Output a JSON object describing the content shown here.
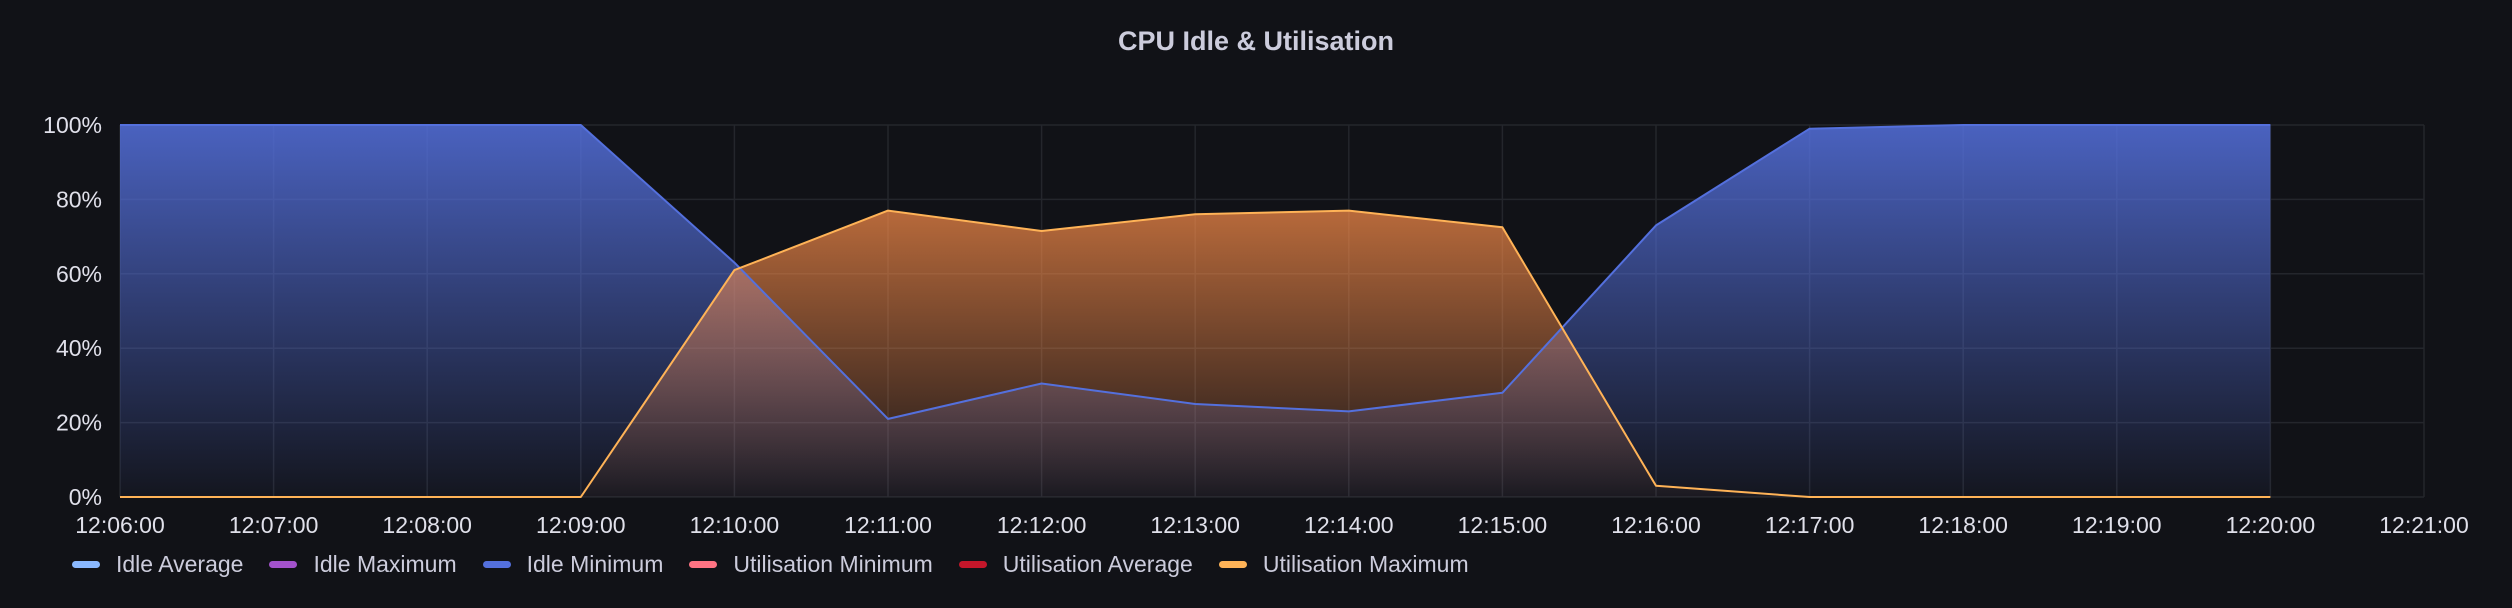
{
  "chart_data": {
    "type": "area",
    "title": "CPU Idle & Utilisation",
    "xlabel": "",
    "ylabel": "",
    "x_ticks": [
      "12:06:00",
      "12:07:00",
      "12:08:00",
      "12:09:00",
      "12:10:00",
      "12:11:00",
      "12:12:00",
      "12:13:00",
      "12:14:00",
      "12:15:00",
      "12:16:00",
      "12:17:00",
      "12:18:00",
      "12:19:00",
      "12:20:00",
      "12:21:00"
    ],
    "y_ticks": [
      "0%",
      "20%",
      "40%",
      "60%",
      "80%",
      "100%"
    ],
    "ylim": [
      0,
      100
    ],
    "x": [
      "12:06:00",
      "12:09:00",
      "12:10:00",
      "12:11:00",
      "12:12:00",
      "12:13:00",
      "12:14:00",
      "12:15:00",
      "12:16:00",
      "12:17:00",
      "12:18:00",
      "12:19:00",
      "12:20:00"
    ],
    "grid": true,
    "legend_position": "bottom-left",
    "series": [
      {
        "name": "Idle Average",
        "color": "#8ab8ff",
        "values": []
      },
      {
        "name": "Idle Maximum",
        "color": "#a352cc",
        "values": []
      },
      {
        "name": "Idle Minimum",
        "color": "#5470dd",
        "values": [
          100,
          100,
          63,
          21,
          30.5,
          25,
          23,
          28,
          73,
          99,
          100,
          100,
          100
        ]
      },
      {
        "name": "Utilisation Minimum",
        "color": "#ff7383",
        "values": []
      },
      {
        "name": "Utilisation Average",
        "color": "#c4162a",
        "values": []
      },
      {
        "name": "Utilisation Maximum",
        "color": "#ffb357",
        "values": [
          0,
          0,
          61,
          77,
          71.5,
          76,
          77,
          72.5,
          3,
          0,
          0,
          0,
          0
        ]
      }
    ]
  }
}
